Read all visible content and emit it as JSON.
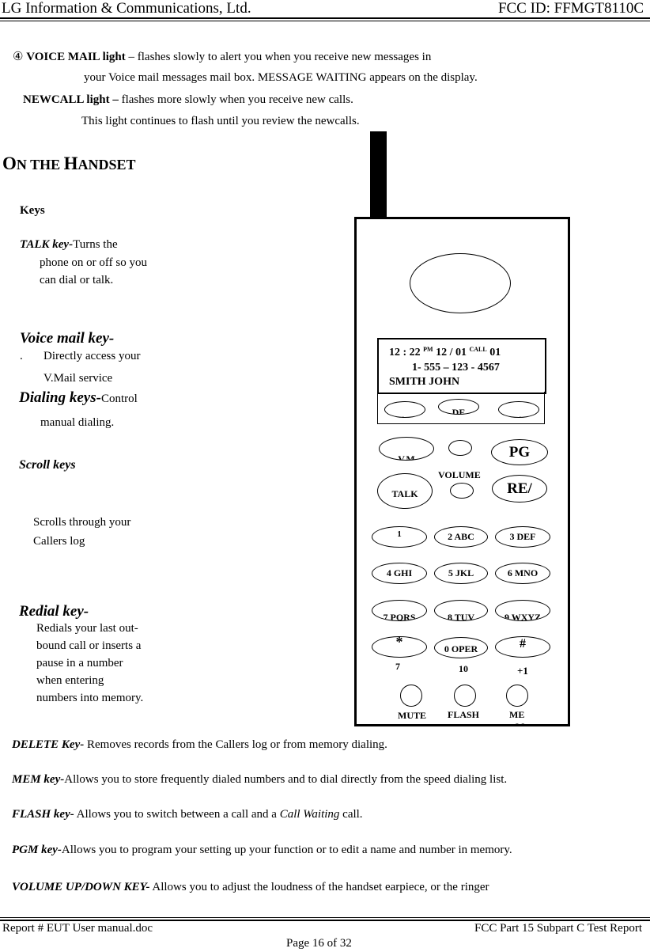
{
  "header": {
    "company": "LG Information & Communications, Ltd.",
    "fcc_id": "FCC ID: FFMGT8110C"
  },
  "intro": {
    "voicemail_marker": "④",
    "voicemail_title": "VOICE MAIL light",
    "voicemail_text1": " – flashes slowly to alert you when you receive new messages in",
    "voicemail_text2": "your Voice mail messages mail box. MESSAGE WAITING appears on the display.",
    "newcall_title": "NEWCALL light –",
    "newcall_text1": " flashes more slowly when you receive new calls.",
    "newcall_text2": "This light continues to flash until you review the newcalls."
  },
  "section": {
    "title_O": "O",
    "title_N": "N THE ",
    "title_H": "H",
    "title_ANDSET": "ANDSET"
  },
  "left_keys": {
    "keys_heading": "Keys",
    "talk_title": "TALK key-",
    "talk_text1": "Turns the",
    "talk_text2": "phone on or off so you",
    "talk_text3": "can dial or talk.",
    "vm_title": "Voice mail key-",
    "vm_bullet": ".",
    "vm_text1": "Directly access your",
    "vm_text2": "V.Mail service",
    "dial_title": "Dialing keys-",
    "dial_text1": "Control",
    "dial_text2": "manual dialing.",
    "scroll_title": "Scroll keys",
    "scroll_text1": "Scrolls through your",
    "scroll_text2": "Callers log",
    "redial_title": "Redial key-",
    "redial_lines": [
      "Redials your last out-",
      "bound call or inserts a",
      "pause in a number",
      "when entering",
      "numbers into memory."
    ]
  },
  "handset": {
    "display": {
      "time": "12 : 22 ",
      "ampm": "PM",
      "date": " 12 / 01 ",
      "call_label": "CALL",
      "call_num": " 01",
      "number": "1- 555 – 123 - 4567",
      "name": "SMITH JOHN"
    },
    "softkeys": {
      "left": "←",
      "center": "DE",
      "right": "→"
    },
    "func_keys": {
      "vm": "V.M",
      "pgm": "PG",
      "talk": "TALK",
      "redial": "RE/",
      "volume": "VOLUME"
    },
    "keypad": [
      "1",
      "2 ABC",
      "3 DEF",
      "4 GHI",
      "5 JKL",
      "6 MNO",
      "7 PQRS",
      "8 TUV",
      "9 WXYZ",
      "*",
      "0 OPER",
      "#"
    ],
    "sublabels": {
      "star": "7",
      "zero": "10",
      "hash": "+1"
    },
    "bottom_keys": {
      "mute": "MUTE",
      "flash": "FLASH",
      "mem": "ME",
      "mem_overflow": "M"
    }
  },
  "descriptions": [
    {
      "title": "DELETE Key-",
      "text": " Removes records from the Callers log or from memory dialing."
    },
    {
      "title": "MEM key-",
      "text": "Allows you to store frequently dialed numbers and to dial directly from the speed dialing list."
    },
    {
      "title": "FLASH key-",
      "text_before": " Allows you to switch between a call and a ",
      "text_italic": "Call Waiting",
      "text_after": " call."
    },
    {
      "title": "PGM key-",
      "text": "Allows you to program your setting up your function or to edit a name and number in memory."
    },
    {
      "title": "VOLUME UP/DOWN KEY-",
      "text": " Allows you to adjust the loudness of the handset earpiece, or the ringer"
    }
  ],
  "footer": {
    "report": "Report # EUT User manual.doc",
    "part": "FCC Part 15 Subpart C Test Report",
    "page": "Page 16 of 32"
  }
}
